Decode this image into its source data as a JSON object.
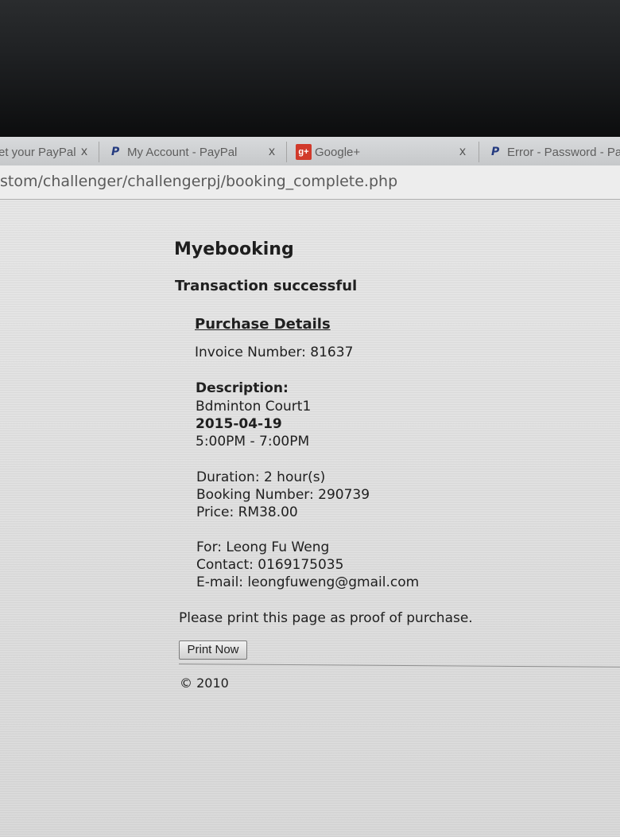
{
  "browser": {
    "tabs": [
      {
        "title": "et your PayPal",
        "close": "x"
      },
      {
        "title": "My Account - PayPal",
        "close": "x"
      },
      {
        "title": "Google+",
        "close": "x"
      },
      {
        "title": "Error - Password - Pa"
      }
    ],
    "url": "stom/challenger/challengerpj/booking_complete.php"
  },
  "page": {
    "site_title": "Myebooking",
    "status": "Transaction successful",
    "details_heading": "Purchase Details",
    "invoice": "Invoice Number: 81637",
    "description_label": "Description:",
    "item": "Bdminton Court1",
    "date": "2015-04-19",
    "time": "5:00PM - 7:00PM",
    "duration": "Duration: 2 hour(s)",
    "booking_number": "Booking Number: 290739",
    "price": "Price: RM38.00",
    "for": "For: Leong Fu Weng",
    "contact": "Contact: 0169175035",
    "email": "E-mail: leongfuweng@gmail.com",
    "print_note": "Please print this page as proof of purchase.",
    "print_button": "Print Now",
    "footer": "© 2010"
  },
  "icons": {
    "paypal": "paypal-icon",
    "google_plus": "google-plus-icon",
    "google_plus_glyph": "g+"
  }
}
